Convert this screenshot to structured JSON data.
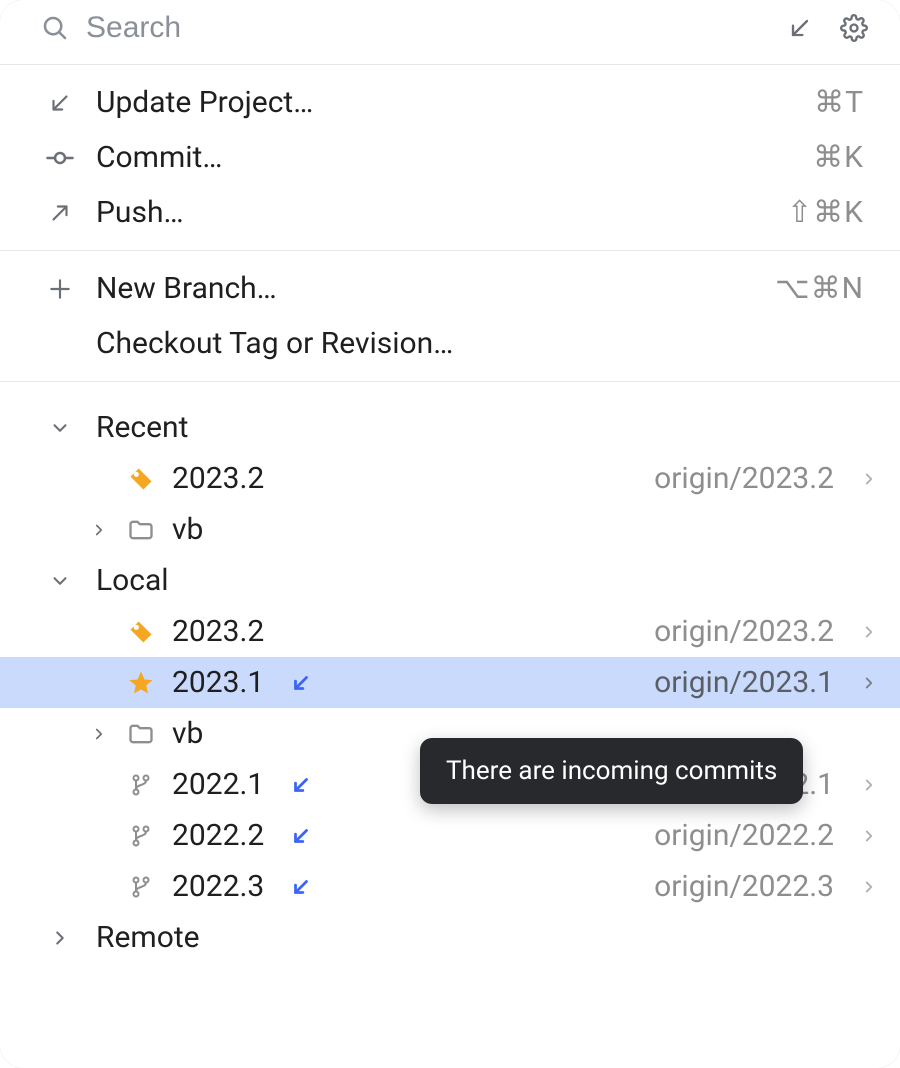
{
  "search": {
    "placeholder": "Search"
  },
  "actions": {
    "update": {
      "label": "Update Project…",
      "shortcut": "⌘T"
    },
    "commit": {
      "label": "Commit…",
      "shortcut": "⌘K"
    },
    "push": {
      "label": "Push…",
      "shortcut": "⇧⌘K"
    },
    "newBranch": {
      "label": "New Branch…",
      "shortcut": "⌥⌘N"
    },
    "checkoutRev": {
      "label": "Checkout Tag or Revision…"
    }
  },
  "groups": {
    "recent": {
      "label": "Recent"
    },
    "local": {
      "label": "Local"
    },
    "remote": {
      "label": "Remote"
    }
  },
  "recent": {
    "r0": {
      "name": "2023.2",
      "remote": "origin/2023.2"
    },
    "r1": {
      "name": "vb"
    }
  },
  "local": {
    "b0": {
      "name": "2023.2",
      "remote": "origin/2023.2"
    },
    "b1": {
      "name": "2023.1",
      "remote": "origin/2023.1"
    },
    "b2": {
      "name": "vb"
    },
    "b3": {
      "name": "2022.1",
      "remote": "origin/2022.1"
    },
    "b4": {
      "name": "2022.2",
      "remote": "origin/2022.2"
    },
    "b5": {
      "name": "2022.3",
      "remote": "origin/2022.3"
    }
  },
  "tooltip": {
    "incoming": "There are incoming commits"
  },
  "colors": {
    "muted": "#8e8e8e",
    "selection": "#c9dafc",
    "amber": "#f5a623",
    "blue": "#3b66f5",
    "tooltipBg": "#27292d"
  }
}
